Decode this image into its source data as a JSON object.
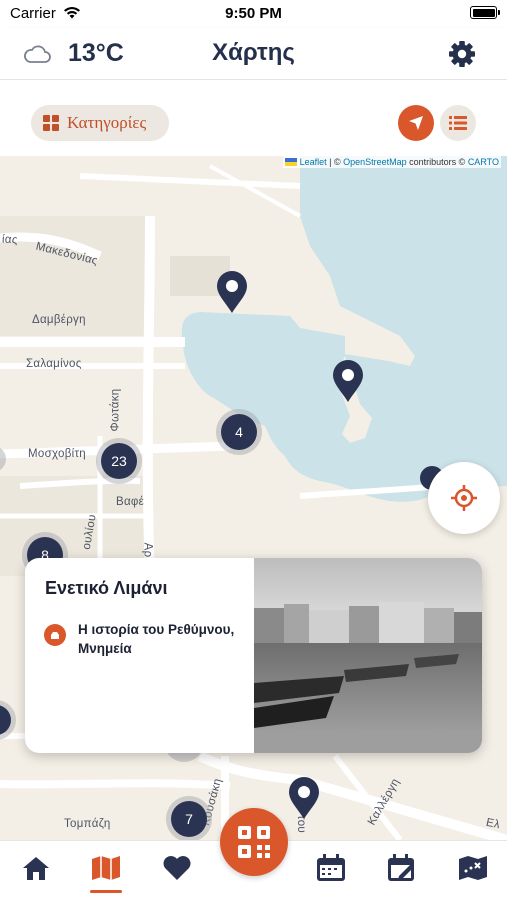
{
  "status_bar": {
    "carrier": "Carrier",
    "time": "9:50 PM"
  },
  "header": {
    "weather_icon": "cloud-icon",
    "temperature": "13°C",
    "title": "Χάρτης",
    "settings_icon": "gear-icon"
  },
  "controls": {
    "categories_label": "Κατηγορίες",
    "location_mode_icon": "navigation-arrow-icon",
    "list_view_icon": "list-icon"
  },
  "map": {
    "attribution": {
      "leaflet": "Leaflet",
      "separator": " | © ",
      "osm": "OpenStreetMap",
      "contributors": " contributors © ",
      "carto": "CARTO"
    },
    "streets": [
      "ίας",
      "Μακεδονίας",
      "Δαμβέργη",
      "Σαλαμίνος",
      "Φωτάκη",
      "Μοσχοβίτη",
      "Βαφέ",
      "ουλίου",
      "Αρ",
      "Τομπάζη",
      "Κουσάκη",
      "Καλλέργη",
      "Ελ",
      "του"
    ],
    "clusters": [
      {
        "count": "4"
      },
      {
        "count": "23"
      },
      {
        "count": "8"
      },
      {
        "count": "7"
      }
    ]
  },
  "card": {
    "title": "Ενετικό Λιμάνι",
    "categories": "Η ιστορία του Ρεθύμνου, Μνημεία"
  },
  "nav": {
    "items": [
      "home-icon",
      "map-icon",
      "heart-icon",
      "qr-code-icon",
      "calendar-icon",
      "calendar-edit-icon",
      "map-marked-icon"
    ],
    "active": "map",
    "accent": "#d9572b",
    "dark": "#2a3452"
  }
}
